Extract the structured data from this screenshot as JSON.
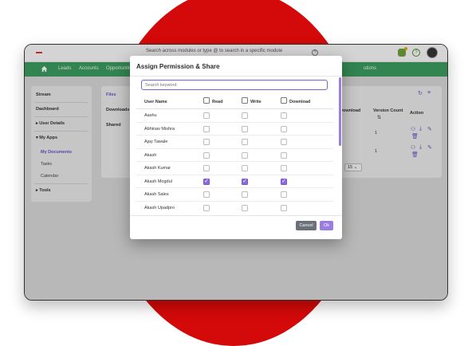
{
  "topbar": {
    "search_placeholder": "Search across modules or type @ to search in a specific module",
    "help_glyph": "?"
  },
  "nav": {
    "items": [
      "Leads",
      "Accounts",
      "Opportunities"
    ],
    "right_partial": "utions"
  },
  "sidebar": {
    "items": [
      "Stream",
      "Dashboard",
      "User Details",
      "My Apps",
      "My Documents",
      "Tasks",
      "Calendar",
      "Tools"
    ]
  },
  "files_panel": {
    "items": [
      "Files",
      "Downloads",
      "Shared"
    ]
  },
  "right_panel": {
    "headers": [
      "Download",
      "Version Count",
      "Action"
    ],
    "rows": [
      {
        "version": "1"
      },
      {
        "version": "1"
      }
    ],
    "page_size": "15"
  },
  "modal": {
    "title": "Assign Permission & Share",
    "search_placeholder": "Search keyword",
    "columns": {
      "user": "User Name",
      "read": "Read",
      "write": "Write",
      "download": "Download"
    },
    "users": [
      {
        "name": "Aashu",
        "read": false,
        "write": false,
        "download": false
      },
      {
        "name": "Abhinav Mishra",
        "read": false,
        "write": false,
        "download": false
      },
      {
        "name": "Ajay Tawale",
        "read": false,
        "write": false,
        "download": false
      },
      {
        "name": "Akash",
        "read": false,
        "write": false,
        "download": false
      },
      {
        "name": "Akash Kumar",
        "read": false,
        "write": false,
        "download": false
      },
      {
        "name": "Akash Mogdul",
        "read": true,
        "write": true,
        "download": true
      },
      {
        "name": "Akash Sales",
        "read": false,
        "write": false,
        "download": false
      },
      {
        "name": "Akash Upadpro",
        "read": false,
        "write": false,
        "download": false
      }
    ],
    "cancel_label": "Cancel",
    "ok_label": "Ok"
  },
  "colors": {
    "accent": "#8b6ad9",
    "nav_green": "#3b9a5e",
    "brand_red": "#d40909"
  }
}
